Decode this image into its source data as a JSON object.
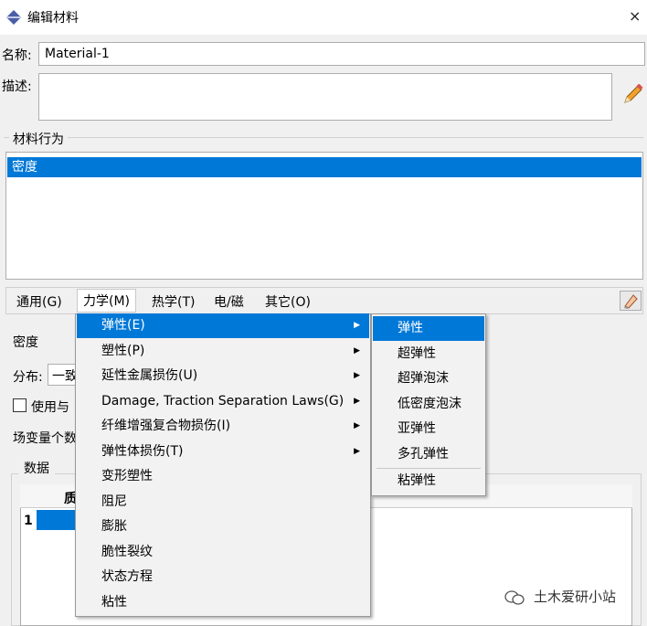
{
  "window": {
    "title": "编辑材料",
    "close": "×"
  },
  "form": {
    "name_label": "名称:",
    "name_value": "Material-1",
    "desc_label": "描述:",
    "desc_value": ""
  },
  "behaviors": {
    "group_title": "材料行为",
    "items": [
      "密度"
    ]
  },
  "menubar": [
    "通用(G)",
    "力学(M)",
    "热学(T)",
    "电/磁",
    "其它(O)"
  ],
  "lower": {
    "density_title": "密度",
    "distribution_label": "分布:",
    "distribution_value": "一致",
    "checkbox_label": "使用与",
    "field_vars_label": "场变量个数",
    "data_group_title": "数据",
    "column_partial": "质",
    "row_number": "1"
  },
  "mechanics_menu": [
    {
      "label": "弹性(E)",
      "submenu": true
    },
    {
      "label": "塑性(P)",
      "submenu": true
    },
    {
      "label": "延性金属损伤(U)",
      "submenu": true
    },
    {
      "label": "Damage, Traction Separation Laws(G)",
      "submenu": true
    },
    {
      "label": "纤维增强复合物损伤(I)",
      "submenu": true
    },
    {
      "label": "弹性体损伤(T)",
      "submenu": true
    },
    {
      "label": "变形塑性",
      "submenu": false
    },
    {
      "label": "阻尼",
      "submenu": false
    },
    {
      "label": "膨胀",
      "submenu": false
    },
    {
      "label": "脆性裂纹",
      "submenu": false
    },
    {
      "label": "状态方程",
      "submenu": false
    },
    {
      "label": "粘性",
      "submenu": false
    }
  ],
  "elastic_submenu": [
    "弹性",
    "超弹性",
    "超弹泡沫",
    "低密度泡沫",
    "亚弹性",
    "多孔弹性",
    "粘弹性"
  ],
  "watermark": "土木爱研小站",
  "colors": {
    "highlight": "#0078d7",
    "background": "#f0f0f0"
  }
}
